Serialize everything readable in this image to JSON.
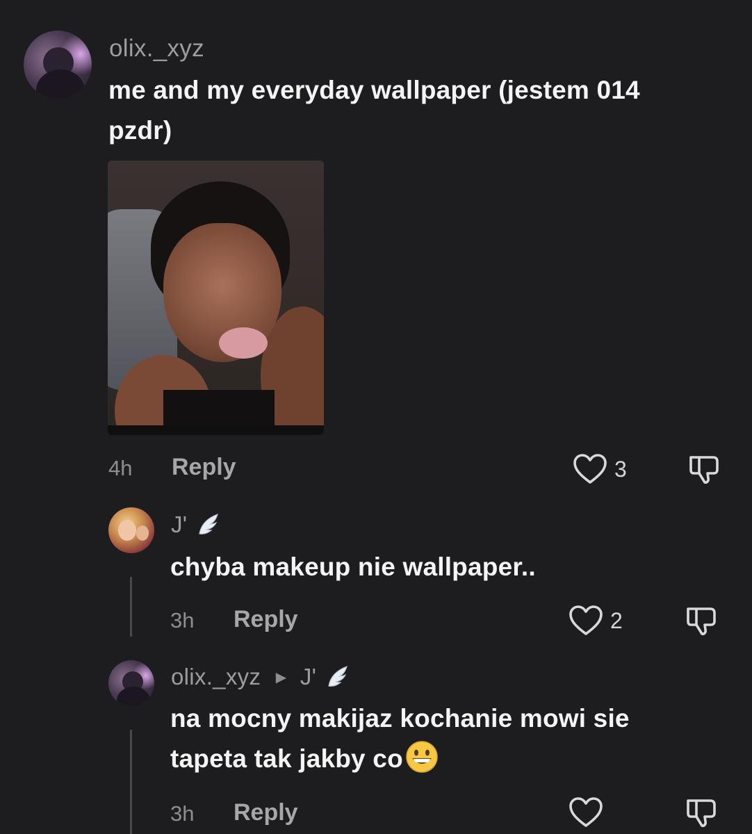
{
  "comments": [
    {
      "username": "olix._xyz",
      "text_line1": "me and my everyday wallpaper (jestem 014",
      "text_line2": "pzdr)",
      "time": "4h",
      "reply_label": "Reply",
      "like_count": "3"
    }
  ],
  "replies": [
    {
      "username": "J'",
      "text": "chyba makeup nie wallpaper..",
      "time": "3h",
      "reply_label": "Reply",
      "like_count": "2"
    },
    {
      "username": "olix._xyz",
      "reply_to": "J'",
      "text_line1": "na mocny makijaz kochanie mowi sie",
      "text_line2": "tapeta tak jakby co",
      "time": "3h",
      "reply_label": "Reply",
      "like_count": ""
    }
  ],
  "icons": {
    "like": "heart-outline-icon",
    "dislike": "thumbs-down-icon",
    "wing": "angel-wing-emoji",
    "grin": "grinning-face-emoji"
  },
  "colors": {
    "background": "#1d1d1f",
    "text": "#f4f4f4",
    "muted": "#9d9d9f"
  }
}
